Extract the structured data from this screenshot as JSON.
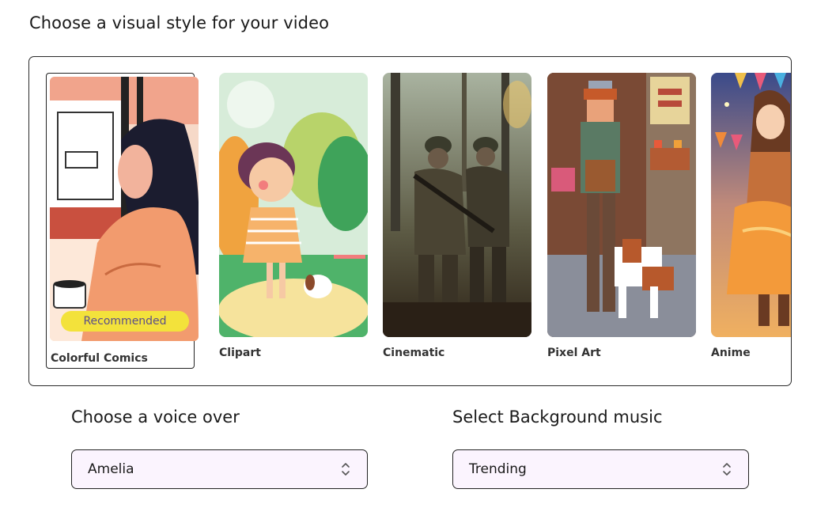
{
  "page_title": "Choose a visual style for your video",
  "styles": [
    {
      "label": "Colorful Comics",
      "selected": true,
      "badge": "Recommended"
    },
    {
      "label": "Clipart"
    },
    {
      "label": "Cinematic"
    },
    {
      "label": "Pixel Art"
    },
    {
      "label": "Anime"
    }
  ],
  "voice": {
    "heading": "Choose a voice over",
    "value": "Amelia"
  },
  "music": {
    "heading": "Select Background music",
    "value": "Trending"
  },
  "colors": {
    "badge_bg": "#f3e23b",
    "select_bg": "#fbf4fe",
    "border": "#222222"
  }
}
